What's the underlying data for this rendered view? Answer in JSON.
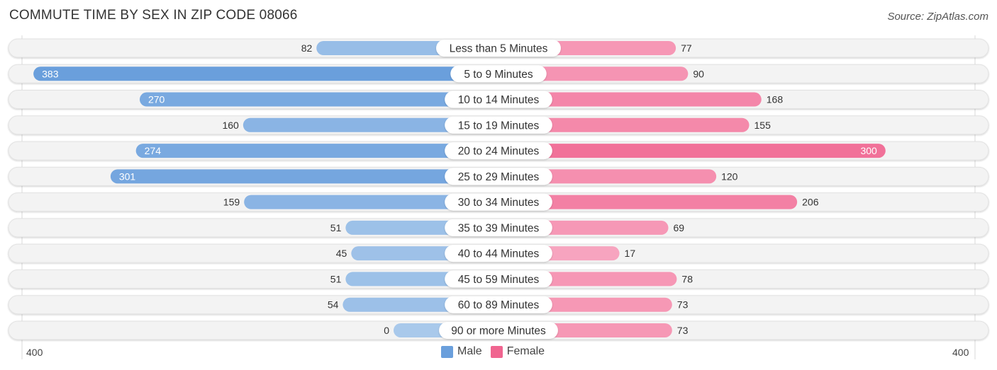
{
  "header": {
    "title": "COMMUTE TIME BY SEX IN ZIP CODE 08066",
    "source": "Source: ZipAtlas.com"
  },
  "legend": {
    "male_label": "Male",
    "female_label": "Female"
  },
  "axis": {
    "left_label": "400",
    "right_label": "400"
  },
  "colors": {
    "male_strong": "#6a9fdc",
    "male_light": "#a9c9eb",
    "female_strong": "#f06590",
    "female_light": "#f8aac3",
    "row_bg": "#f3f3f3"
  },
  "chart_data": {
    "type": "bar",
    "orientation": "horizontal-diverging",
    "title": "COMMUTE TIME BY SEX IN ZIP CODE 08066",
    "categories": [
      "Less than 5 Minutes",
      "5 to 9 Minutes",
      "10 to 14 Minutes",
      "15 to 19 Minutes",
      "20 to 24 Minutes",
      "25 to 29 Minutes",
      "30 to 34 Minutes",
      "35 to 39 Minutes",
      "40 to 44 Minutes",
      "45 to 59 Minutes",
      "60 to 89 Minutes",
      "90 or more Minutes"
    ],
    "series": [
      {
        "name": "Male",
        "values": [
          82,
          383,
          270,
          160,
          274,
          301,
          159,
          51,
          45,
          51,
          54,
          0
        ]
      },
      {
        "name": "Female",
        "values": [
          77,
          90,
          168,
          155,
          300,
          120,
          206,
          69,
          17,
          78,
          73,
          73
        ]
      }
    ],
    "xlim": [
      -400,
      400
    ],
    "tick_labels": [
      "400",
      "400"
    ],
    "legend_position": "bottom-center",
    "grid": false
  }
}
